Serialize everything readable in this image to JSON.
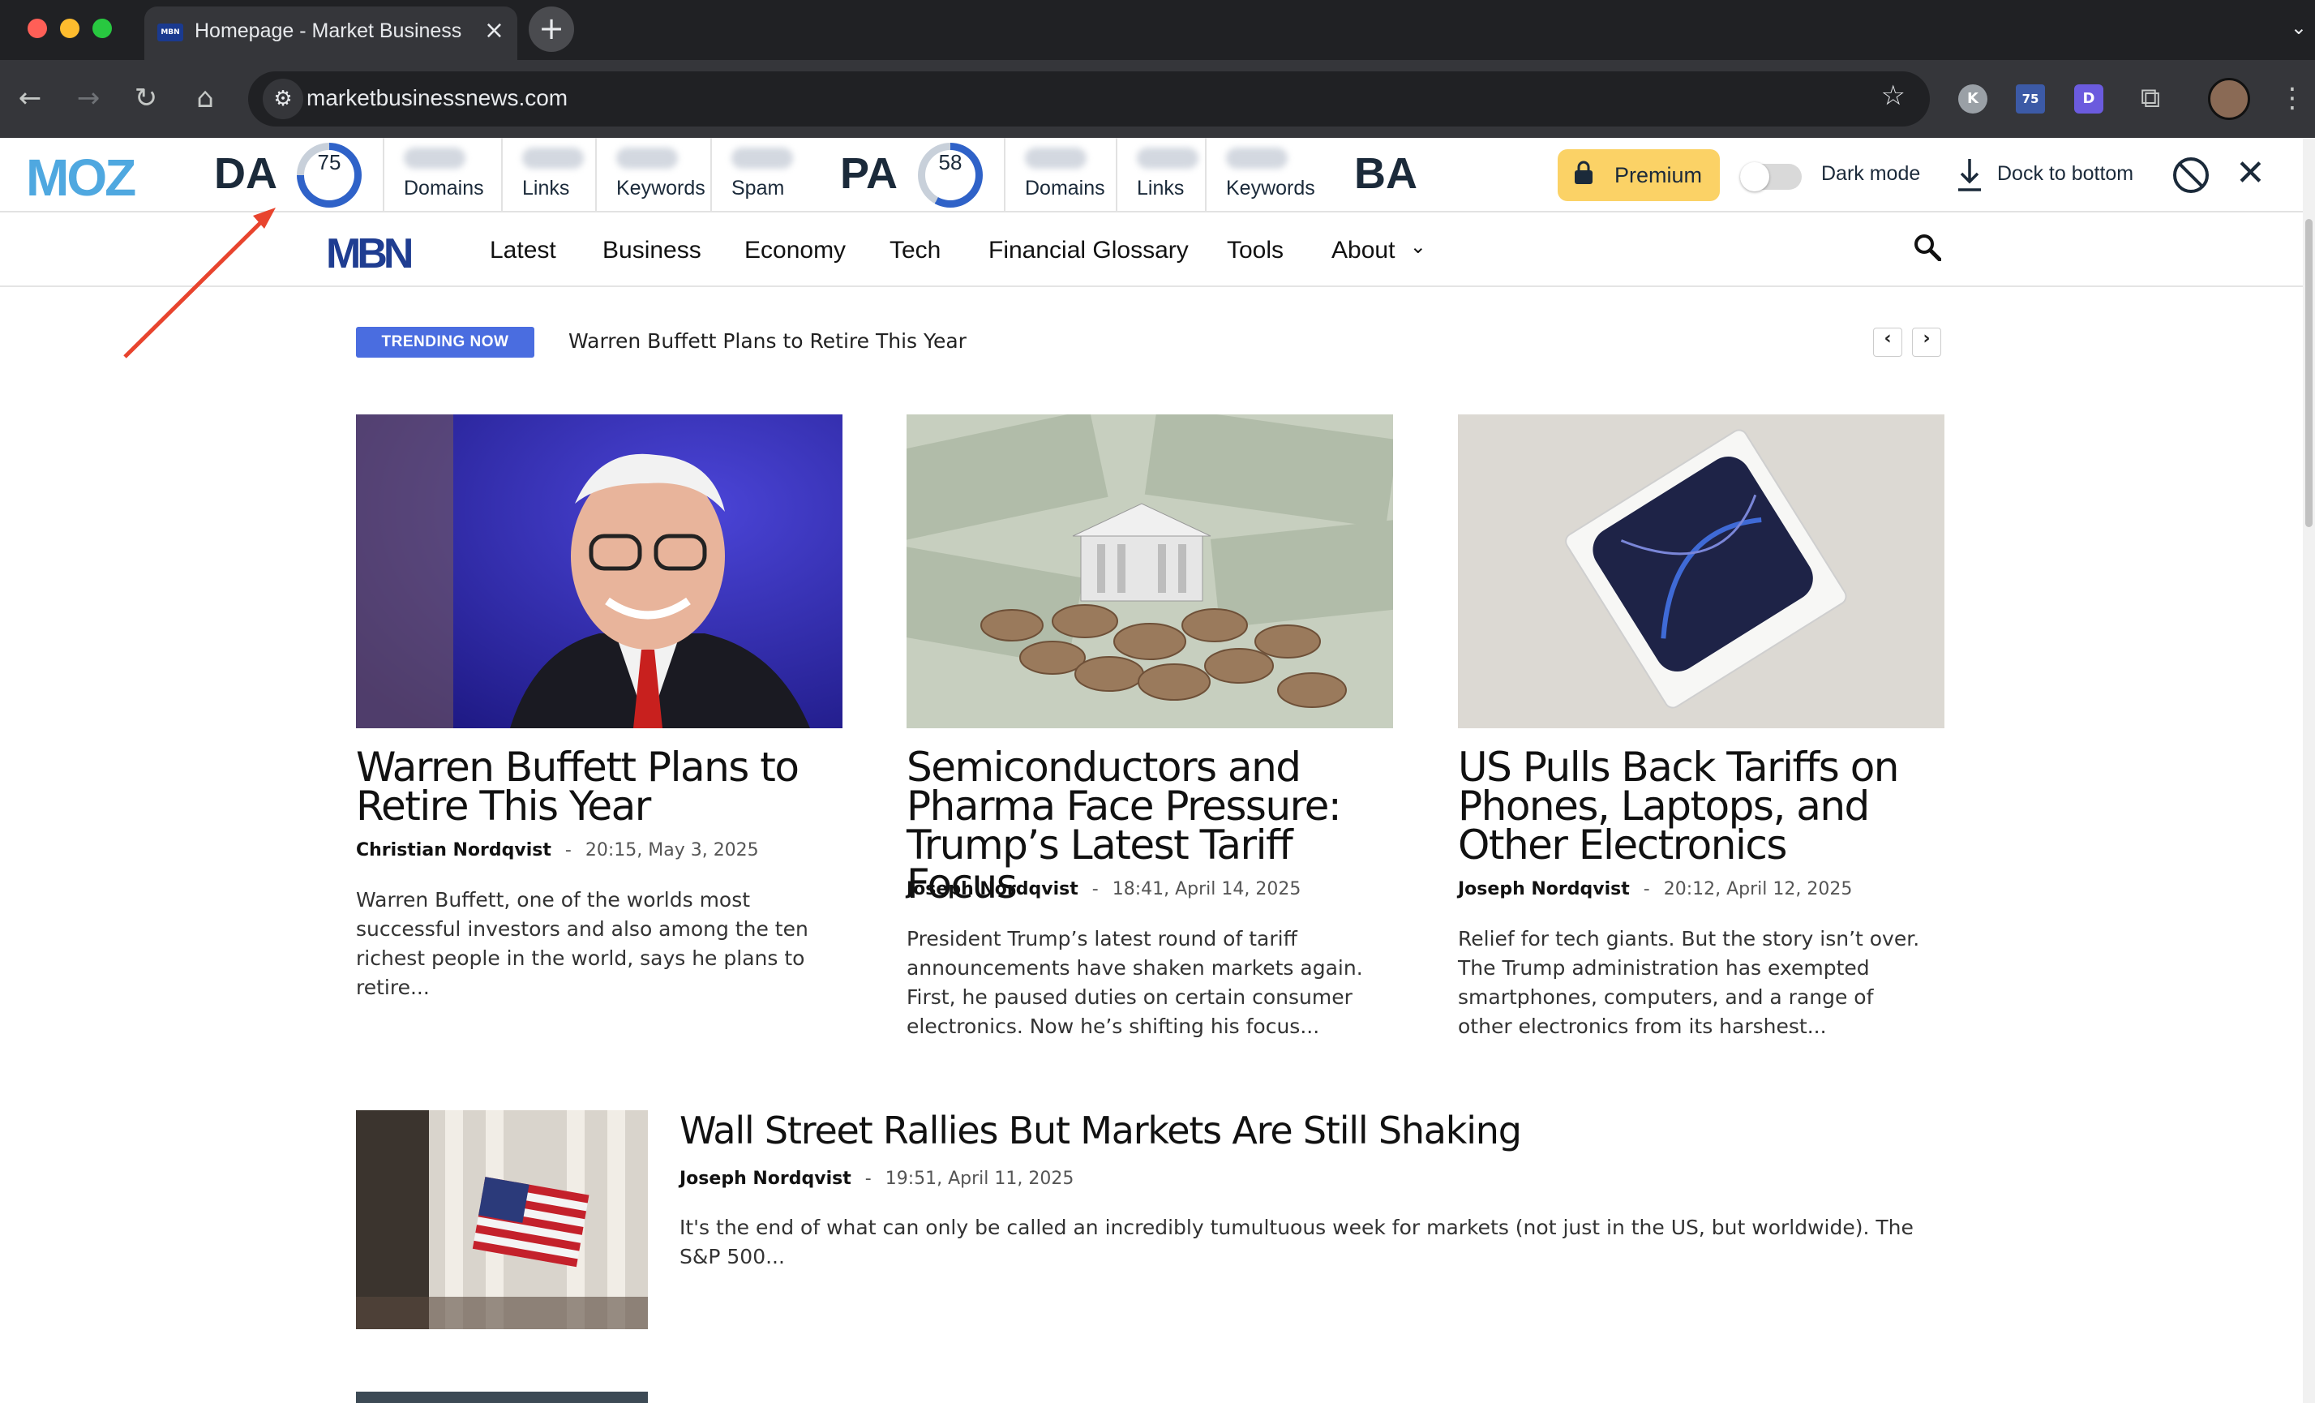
{
  "browser": {
    "tab_title": "Homepage - Market Business News",
    "tab_favicon_text": "MBN",
    "url": "marketbusinessnews.com",
    "extensions": [
      "K",
      "75",
      "D"
    ]
  },
  "moz": {
    "logo": "MOZ",
    "da_label": "DA",
    "da_value": "75",
    "da_metrics": [
      "Domains",
      "Links",
      "Keywords",
      "Spam"
    ],
    "pa_label": "PA",
    "pa_value": "58",
    "pa_metrics": [
      "Domains",
      "Links",
      "Keywords"
    ],
    "ba_label": "BA",
    "premium_label": "Premium",
    "dark_mode_label": "Dark mode",
    "dark_mode_on": false,
    "dock_label": "Dock to bottom",
    "colors": {
      "ring": "#2f62c8",
      "ring_track": "#c8d0da",
      "premium": "#fbd266"
    }
  },
  "site": {
    "logo": "MBN",
    "nav": [
      "Latest",
      "Business",
      "Economy",
      "Tech",
      "Financial Glossary",
      "Tools",
      "About"
    ],
    "about_caret": "⌄",
    "trending_badge": "TRENDING NOW",
    "trending_text": "Warren Buffett Plans to Retire This Year",
    "prev_arrow": "‹",
    "next_arrow": "›"
  },
  "articles": [
    {
      "title": "Warren Buffett Plans to Retire This Year",
      "author": "Christian Nordqvist",
      "date": "20:15, May 3, 2025",
      "excerpt": "Warren Buffett, one of the worlds most successful investors and also among the ten richest people in the world, says he plans to retire..."
    },
    {
      "title": "Semiconductors and Pharma Face Pressure: Trump’s Latest Tariff Focus",
      "author": "Joseph Nordqvist",
      "date": "18:41, April 14, 2025",
      "excerpt": "President Trump’s latest round of tariff announcements have shaken markets again. First, he paused duties on certain consumer electronics. Now he’s shifting his focus..."
    },
    {
      "title": "US Pulls Back Tariffs on Phones, Laptops, and Other Electronics",
      "author": "Joseph Nordqvist",
      "date": "20:12, April 12, 2025",
      "excerpt": "Relief for tech giants. But the story isn’t over. The Trump administration has exempted smartphones, computers, and a range of other electronics from its harshest..."
    },
    {
      "title": "Wall Street Rallies But Markets Are Still Shaking",
      "author": "Joseph Nordqvist",
      "date": "19:51, April 11, 2025",
      "excerpt": "It's the end of what can only be called an incredibly tumultuous week for markets (not just in the US, but worldwide). The S&P 500..."
    }
  ],
  "meta_separator": "-"
}
